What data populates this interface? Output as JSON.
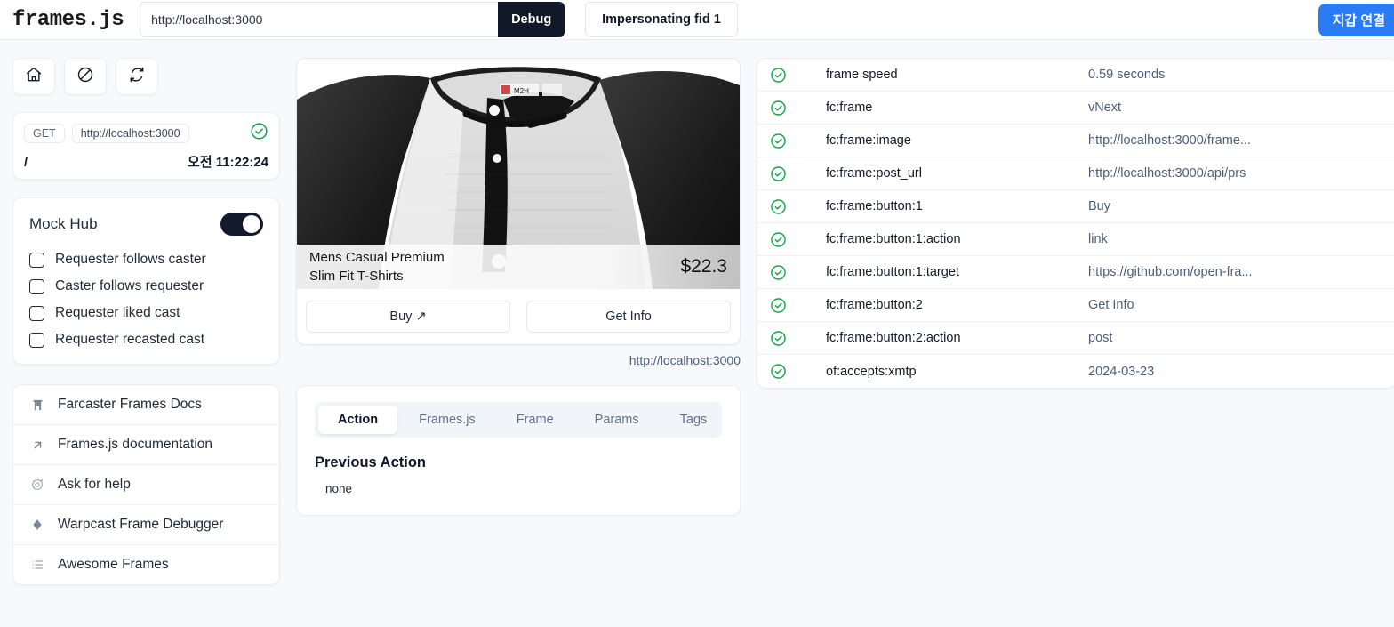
{
  "topbar": {
    "logo": "frames.js",
    "url_value": "http://localhost:3000",
    "url_placeholder": "http://localhost:3000",
    "debug_label": "Debug",
    "impersonate_label": "Impersonating fid 1",
    "connect_wallet_label": "지갑 연결",
    "accent_blue": "#2a7bf6",
    "debug_bg": "#111827"
  },
  "sidebar": {
    "icon_buttons": [
      {
        "name": "home-icon",
        "label": "Home"
      },
      {
        "name": "block-icon",
        "label": "Clear"
      },
      {
        "name": "refresh-icon",
        "label": "Refresh"
      }
    ],
    "request": {
      "method": "GET",
      "url": "http://localhost:3000",
      "path": "/",
      "time": "오전 11:22:24",
      "status": "ok",
      "status_color": "#16a34a"
    },
    "mock_hub": {
      "title": "Mock Hub",
      "enabled": true,
      "options": [
        {
          "label": "Requester follows caster",
          "checked": false
        },
        {
          "label": "Caster follows requester",
          "checked": false
        },
        {
          "label": "Requester liked cast",
          "checked": false
        },
        {
          "label": "Requester recasted cast",
          "checked": false
        }
      ]
    },
    "links": [
      {
        "label": "Farcaster Frames Docs",
        "icon": "farcaster-arch-icon"
      },
      {
        "label": "Frames.js documentation",
        "icon": "arrow-up-right-icon"
      },
      {
        "label": "Ask for help",
        "icon": "chat-bubble-icon"
      },
      {
        "label": "Warpcast Frame Debugger",
        "icon": "diamond-icon"
      },
      {
        "label": "Awesome Frames",
        "icon": "list-icon"
      }
    ]
  },
  "frame": {
    "image_title": "Mens Casual Premium\nSlim Fit T-Shirts",
    "image_title_line1": "Mens Casual Premium",
    "image_title_line2": "Slim Fit T-Shirts",
    "price": "$22.3",
    "buttons": [
      {
        "label": "Buy",
        "external": true,
        "glyph": "↗"
      },
      {
        "label": "Get Info",
        "external": false,
        "glyph": ""
      }
    ],
    "frame_url": "http://localhost:3000"
  },
  "tabs_panel": {
    "tabs": [
      {
        "label": "Action",
        "active": true
      },
      {
        "label": "Frames.js",
        "active": false
      },
      {
        "label": "Frame",
        "active": false
      },
      {
        "label": "Params",
        "active": false
      },
      {
        "label": "Tags",
        "active": false
      }
    ],
    "previous_action_title": "Previous Action",
    "previous_action_value": "none"
  },
  "metadata_table": {
    "rows": [
      {
        "status": "ok",
        "key": "frame speed",
        "value": "0.59 seconds"
      },
      {
        "status": "ok",
        "key": "fc:frame",
        "value": "vNext"
      },
      {
        "status": "ok",
        "key": "fc:frame:image",
        "value": "http://localhost:3000/frame..."
      },
      {
        "status": "ok",
        "key": "fc:frame:post_url",
        "value": "http://localhost:3000/api/prs"
      },
      {
        "status": "ok",
        "key": "fc:frame:button:1",
        "value": "Buy"
      },
      {
        "status": "ok",
        "key": "fc:frame:button:1:action",
        "value": "link"
      },
      {
        "status": "ok",
        "key": "fc:frame:button:1:target",
        "value": "https://github.com/open-fra..."
      },
      {
        "status": "ok",
        "key": "fc:frame:button:2",
        "value": "Get Info"
      },
      {
        "status": "ok",
        "key": "fc:frame:button:2:action",
        "value": "post"
      },
      {
        "status": "ok",
        "key": "of:accepts:xmtp",
        "value": "2024-03-23"
      }
    ]
  }
}
